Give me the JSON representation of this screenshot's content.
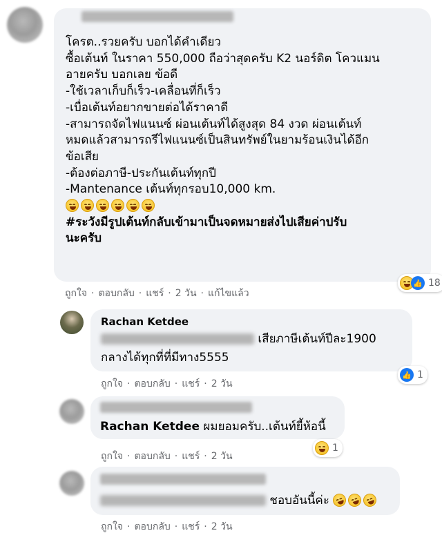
{
  "main_comment": {
    "lines": [
      "โครต..รวยครับ บอกได้คำเดียว",
      "ซื้อเต้นท์ ในราคา 550,000 ถือว่าสุดครับ K2 นอร์ดิต โควแมน",
      "อายครับ บอกเลย ข้อดี",
      "-ใช้เวลาเก็บก็เร็ว-เคลื่อนที่ก็เร็ว",
      "-เบื่อเต้นท์อยากขายต่อได้ราคาดี",
      "-สามารถจัดไฟแนนซ์ ผ่อนเต้นท์ได้สูงสุด 84 งวด ผ่อนเต้นท์",
      "หมดแล้วสามารถรีไฟแนนซ์เป็นสินทรัพย์ในยามร้อนเงินได้อีก",
      "ข้อเสีย",
      "-ต้องต่อภาษี-ประกันเต้นท์ทุกปี",
      "-Mantenance เต้นท์ทุกรอบ10,000 km."
    ],
    "hashtag_line1": "#ระวังมีรูปเต้นท์กลับเข้ามาเป็นจดหมายส่งไปเสียค่าปรับ",
    "hashtag_line2": "นะครับ",
    "reaction_count": "18",
    "actions": {
      "like": "ถูกใจ",
      "reply": "ตอบกลับ",
      "share": "แชร์",
      "time": "2 วัน",
      "edited": "แก้ไขแล้ว"
    }
  },
  "reply1": {
    "author": "Rachan Ketdee",
    "line1": "เสียภาษีเต้นท์ปีละ1900",
    "line2": "กลางได้ทุกที่ที่มีทาง5555",
    "reaction_count": "1",
    "actions": {
      "like": "ถูกใจ",
      "reply": "ตอบกลับ",
      "share": "แชร์",
      "time": "2 วัน"
    }
  },
  "reply2": {
    "mention": "Rachan Ketdee",
    "text": " ผมยอมครับ..เต้นท์ยี้ห้อนี้",
    "reaction_count": "1",
    "actions": {
      "like": "ถูกใจ",
      "reply": "ตอบกลับ",
      "share": "แชร์",
      "time": "2 วัน"
    }
  },
  "reply3": {
    "text": "ชอบอันนี้ค่ะ",
    "actions": {
      "like": "ถูกใจ",
      "reply": "ตอบกลับ",
      "share": "แชร์",
      "time": "2 วัน"
    }
  },
  "colors": {
    "bubble": "#f0f2f5",
    "meta": "#65676b",
    "like_blue": "#1877f2"
  }
}
